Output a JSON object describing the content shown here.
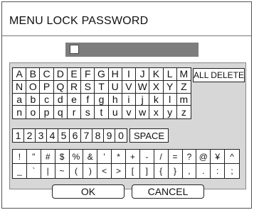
{
  "dialog": {
    "title": "MENU LOCK PASSWORD"
  },
  "keyboard": {
    "letters": [
      "A",
      "B",
      "C",
      "D",
      "E",
      "F",
      "G",
      "H",
      "I",
      "J",
      "K",
      "L",
      "M",
      "N",
      "O",
      "P",
      "Q",
      "R",
      "S",
      "T",
      "U",
      "V",
      "W",
      "X",
      "Y",
      "Z",
      "a",
      "b",
      "c",
      "d",
      "e",
      "f",
      "g",
      "h",
      "i",
      "j",
      "k",
      "l",
      "m",
      "n",
      "o",
      "p",
      "q",
      "r",
      "s",
      "t",
      "u",
      "v",
      "w",
      "x",
      "y",
      "z"
    ],
    "digits": [
      "1",
      "2",
      "3",
      "4",
      "5",
      "6",
      "7",
      "8",
      "9",
      "0"
    ],
    "symbols": [
      "!",
      "\"",
      "#",
      "$",
      "%",
      "&",
      "'",
      "*",
      "+",
      "-",
      "/",
      "=",
      "?",
      "@",
      "¥",
      "^",
      "_",
      "`",
      "|",
      "~",
      "(",
      ")",
      "<",
      ">",
      "[",
      "]",
      "{",
      "}",
      ",",
      ".",
      ":",
      ";"
    ],
    "all_delete_label": "ALL DELETE",
    "space_label": "SPACE"
  },
  "buttons": {
    "ok_label": "OK",
    "cancel_label": "CANCEL"
  }
}
